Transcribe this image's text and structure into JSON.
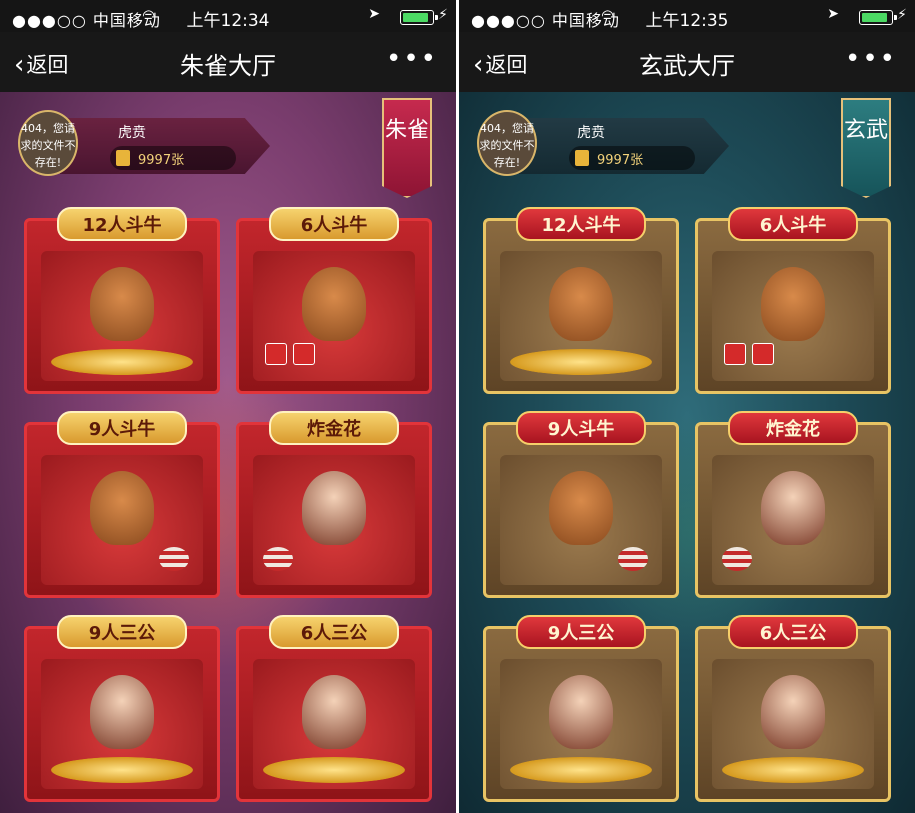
{
  "phones": [
    {
      "status": {
        "signal": "●●●○○ 中国移动",
        "time": "上午12:34",
        "battery_level": 0.9
      },
      "nav": {
        "back_label": "返回",
        "title": "朱雀大厅"
      },
      "user": {
        "avatar_text": "404，您请求的文件不存在!",
        "name": "虎贲",
        "cards": "9997张"
      },
      "ribbon": "朱雀",
      "games": [
        {
          "label": "12人斗牛"
        },
        {
          "label": "6人斗牛"
        },
        {
          "label": "9人斗牛"
        },
        {
          "label": "炸金花"
        },
        {
          "label": "9人三公"
        },
        {
          "label": "6人三公"
        }
      ]
    },
    {
      "status": {
        "signal": "●●●○○ 中国移动",
        "time": "上午12:35",
        "battery_level": 0.9
      },
      "nav": {
        "back_label": "返回",
        "title": "玄武大厅"
      },
      "user": {
        "avatar_text": "404，您请求的文件不存在!",
        "name": "虎贲",
        "cards": "9997张"
      },
      "ribbon": "玄武",
      "games": [
        {
          "label": "12人斗牛"
        },
        {
          "label": "6人斗牛"
        },
        {
          "label": "9人斗牛"
        },
        {
          "label": "炸金花"
        },
        {
          "label": "9人三公"
        },
        {
          "label": "6人三公"
        }
      ]
    }
  ],
  "icons": {
    "wifi": "wifi-icon",
    "location": "location-arrow-icon",
    "battery": "battery-icon",
    "charging": "charging-bolt-icon",
    "back": "chevron-left-icon",
    "more": "more-dots-icon",
    "room_card": "room-card-icon"
  },
  "colors": {
    "zhuque_accent": "#c2262c",
    "xuanwu_accent": "#e8c464",
    "battery_green": "#4cd964"
  }
}
